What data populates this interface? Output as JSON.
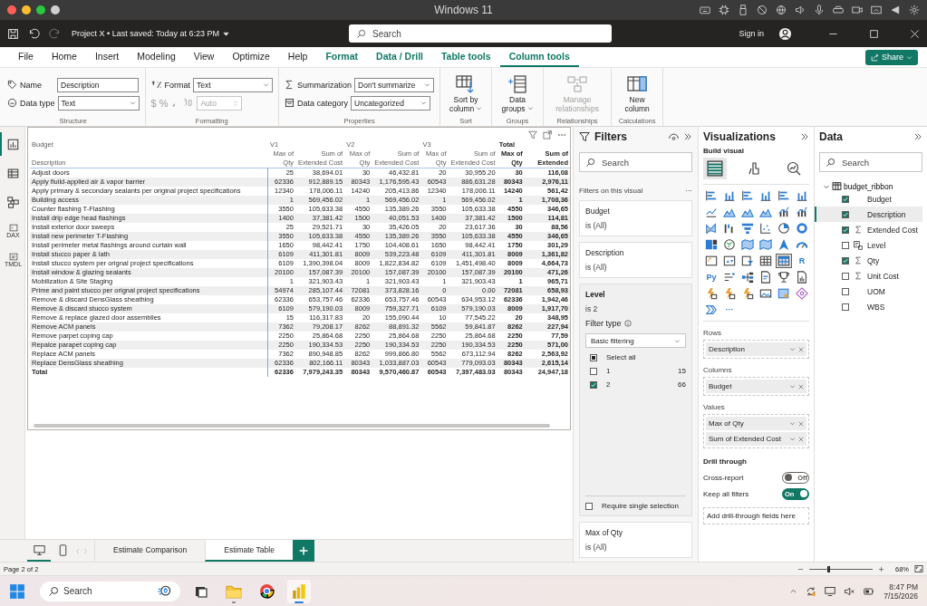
{
  "window": {
    "title": "Windows 11"
  },
  "app_bar": {
    "document": "Project X • Last saved: Today at 6:23 PM",
    "search_placeholder": "Search",
    "sign_in": "Sign in"
  },
  "ribbon_tabs": [
    {
      "label": "File",
      "kind": "main",
      "selected": false
    },
    {
      "label": "Home",
      "kind": "main",
      "selected": false
    },
    {
      "label": "Insert",
      "kind": "main",
      "selected": false
    },
    {
      "label": "Modeling",
      "kind": "main",
      "selected": false
    },
    {
      "label": "View",
      "kind": "main",
      "selected": false
    },
    {
      "label": "Optimize",
      "kind": "main",
      "selected": false
    },
    {
      "label": "Help",
      "kind": "main",
      "selected": false
    },
    {
      "label": "Format",
      "kind": "contextual",
      "selected": false
    },
    {
      "label": "Data / Drill",
      "kind": "contextual",
      "selected": false
    },
    {
      "label": "Table tools",
      "kind": "contextual",
      "selected": false
    },
    {
      "label": "Column tools",
      "kind": "contextual",
      "selected": true
    }
  ],
  "share": "Share",
  "ribbon_groups": [
    {
      "name": "Structure",
      "kind": "fields",
      "fields": [
        {
          "label": "Name",
          "value": "Description",
          "kind": "input"
        },
        {
          "label": "Data type",
          "value": "Text",
          "kind": "select"
        }
      ]
    },
    {
      "name": "Formatting",
      "kind": "format",
      "fields": [
        {
          "label": "Format",
          "value": "Text",
          "kind": "select"
        }
      ],
      "number_buttons": [
        "$",
        "%"
      ],
      "decimal_field": {
        "placeholder": "Auto",
        "disabled": true
      }
    },
    {
      "name": "Properties",
      "kind": "fields",
      "fields": [
        {
          "label": "Summarization",
          "value": "Don't summarize",
          "kind": "select"
        },
        {
          "label": "Data category",
          "value": "Uncategorized",
          "kind": "select"
        }
      ]
    },
    {
      "name": "Sort",
      "kind": "button",
      "label": "Sort by column",
      "dropdown": true,
      "disabled": false
    },
    {
      "name": "Groups",
      "kind": "button",
      "label": "Data groups",
      "dropdown": true,
      "disabled": false
    },
    {
      "name": "Relationships",
      "kind": "button",
      "label": "Manage relationships",
      "dropdown": false,
      "disabled": true
    },
    {
      "name": "Calculations",
      "kind": "button",
      "label": "New column",
      "dropdown": false,
      "disabled": false
    }
  ],
  "rail": [
    {
      "kind": "report",
      "selected": true
    },
    {
      "kind": "table",
      "selected": false
    },
    {
      "kind": "model",
      "selected": false
    },
    {
      "kind": "dax",
      "label": "DAX",
      "selected": false
    },
    {
      "kind": "tmdl",
      "label": "TMDL",
      "selected": false
    }
  ],
  "matrix": {
    "column_groups": [
      "Budget",
      "V1",
      "V2",
      "V3",
      "Total"
    ],
    "columns": [
      "Description",
      "Max of Qty",
      "Sum of Extended Cost",
      "Max of Qty",
      "Sum of Extended Cost",
      "Max of Qty",
      "Sum of Extended Cost",
      "Max of Qty",
      "Sum of Extended"
    ],
    "rows": [
      [
        "Adjust doors",
        "25",
        "38,694.01",
        "30",
        "46,432.81",
        "20",
        "30,955.20",
        "30",
        "116,08"
      ],
      [
        "Apply fluild-applied air & vapor barrier",
        "62336",
        "912,889.15",
        "80343",
        "1,176,595.43",
        "60543",
        "886,631.28",
        "80343",
        "2,976,11"
      ],
      [
        "Apply primary & secondary sealants per original project specifications",
        "12340",
        "178,006.11",
        "14240",
        "205,413.86",
        "12340",
        "178,006.11",
        "14240",
        "561,42"
      ],
      [
        "Building access",
        "1",
        "569,456.02",
        "1",
        "569,456.02",
        "1",
        "569,456.02",
        "1",
        "1,708,36"
      ],
      [
        "Counter flashing T-Flashing",
        "3550",
        "105,633.38",
        "4550",
        "135,389.26",
        "3550",
        "105,633.38",
        "4550",
        "346,65"
      ],
      [
        "Install drip edge head flashings",
        "1400",
        "37,381.42",
        "1500",
        "40,051.53",
        "1400",
        "37,381.42",
        "1500",
        "114,81"
      ],
      [
        "Install exterior door sweeps",
        "25",
        "29,521.71",
        "30",
        "35,426.05",
        "20",
        "23,617.36",
        "30",
        "88,56"
      ],
      [
        "Install new perimeter T-Flashing",
        "3550",
        "105,633.38",
        "4550",
        "135,389.26",
        "3550",
        "105,633.38",
        "4550",
        "346,65"
      ],
      [
        "Install perimeter metal flashings around curtain wall",
        "1650",
        "98,442.41",
        "1750",
        "104,408.61",
        "1650",
        "98,442.41",
        "1750",
        "301,29"
      ],
      [
        "Install stucco paper & lath",
        "6109",
        "411,301.81",
        "8009",
        "539,223.48",
        "6109",
        "411,301.81",
        "8009",
        "1,361,82"
      ],
      [
        "Install stucco system per orignal project specifications",
        "6109",
        "1,390,398.04",
        "8009",
        "1,822,834.82",
        "6109",
        "1,451,498.40",
        "8009",
        "4,664,73"
      ],
      [
        "Install window & glazing sealants",
        "20100",
        "157,087.39",
        "20100",
        "157,087.39",
        "20100",
        "157,087.39",
        "20100",
        "471,26"
      ],
      [
        "Mobilization & Site Staging",
        "1",
        "321,903.43",
        "1",
        "321,903.43",
        "1",
        "321,903.43",
        "1",
        "965,71"
      ],
      [
        "Prime and paint stucco per orignal project specifications",
        "54974",
        "285,107.44",
        "72081",
        "373,828.16",
        "0",
        "0.00",
        "72081",
        "658,93"
      ],
      [
        "Remove & discard DensGlass sheathing",
        "62336",
        "653,757.46",
        "62336",
        "653,757.46",
        "60543",
        "634,953.12",
        "62336",
        "1,942,46"
      ],
      [
        "Remove & discard stucco system",
        "6109",
        "579,190.03",
        "8009",
        "759,327.71",
        "6109",
        "579,190.03",
        "8009",
        "1,917,70"
      ],
      [
        "Remove & replace glazed door assemblies",
        "15",
        "116,317.83",
        "20",
        "155,090.44",
        "10",
        "77,545.22",
        "20",
        "348,95"
      ],
      [
        "Remove ACM panels",
        "7362",
        "79,208.17",
        "8262",
        "88,891.32",
        "5562",
        "59,841.87",
        "8262",
        "227,94"
      ],
      [
        "Remove parpet coping cap",
        "2250",
        "25,864.68",
        "2250",
        "25,864.68",
        "2250",
        "25,864.68",
        "2250",
        "77,59"
      ],
      [
        "Repalce parapet coping cap",
        "2250",
        "190,334.53",
        "2250",
        "190,334.53",
        "2250",
        "190,334.53",
        "2250",
        "571,00"
      ],
      [
        "Replace ACM panels",
        "7362",
        "890,948.85",
        "8262",
        "999,866.80",
        "5562",
        "673,112.94",
        "8262",
        "2,563,92"
      ],
      [
        "Replace DensGlass sheathing",
        "62336",
        "802,166.11",
        "80343",
        "1,033,887.03",
        "60543",
        "779,093.03",
        "80343",
        "2,615,14"
      ]
    ],
    "total": [
      "Total",
      "62336",
      "7,979,243.35",
      "80343",
      "9,570,460.87",
      "60543",
      "7,397,483.03",
      "80343",
      "24,947,18"
    ]
  },
  "filters": {
    "title": "Filters",
    "search_placeholder": "Search",
    "section": "Filters on this visual",
    "more": "···",
    "cards": [
      {
        "field": "Budget",
        "summary": "is (All)",
        "expanded": false
      },
      {
        "field": "Description",
        "summary": "is (All)",
        "expanded": false
      },
      {
        "field": "Level",
        "summary": "is 2",
        "expanded": true,
        "filter_type_label": "Filter type",
        "filter_type": "Basic filtering",
        "options": [
          {
            "label": "Select all",
            "kind": "select-all",
            "partial": true
          },
          {
            "label": "1",
            "count": "15",
            "kind": "value",
            "checked": false
          },
          {
            "label": "2",
            "count": "66",
            "kind": "value",
            "checked": true
          }
        ],
        "require_single": {
          "label": "Require single selection",
          "checked": false
        }
      },
      {
        "field": "Max of Qty",
        "summary": "is (All)",
        "expanded": false
      }
    ]
  },
  "visualizations": {
    "title": "Visualizations",
    "subtitle": "Build visual",
    "build_tabs": [
      {
        "kind": "build",
        "selected": true
      },
      {
        "kind": "format",
        "selected": false
      },
      {
        "kind": "analytics",
        "selected": false
      }
    ],
    "types": [
      {
        "kind": "bar",
        "selected": false
      },
      {
        "kind": "column",
        "selected": false
      },
      {
        "kind": "bar",
        "selected": false
      },
      {
        "kind": "column",
        "selected": false
      },
      {
        "kind": "bar",
        "selected": false
      },
      {
        "kind": "column",
        "selected": false
      },
      {
        "kind": "line",
        "selected": false
      },
      {
        "kind": "area",
        "selected": false
      },
      {
        "kind": "area",
        "selected": false
      },
      {
        "kind": "area",
        "selected": false
      },
      {
        "kind": "combo",
        "selected": false
      },
      {
        "kind": "combo",
        "selected": false
      },
      {
        "kind": "ribbon",
        "selected": false
      },
      {
        "kind": "waterfall",
        "selected": false
      },
      {
        "kind": "funnel",
        "selected": false
      },
      {
        "kind": "scatter",
        "selected": false
      },
      {
        "kind": "pie",
        "selected": false
      },
      {
        "kind": "donut",
        "selected": false
      },
      {
        "kind": "treemap",
        "selected": false
      },
      {
        "kind": "globe",
        "selected": false
      },
      {
        "kind": "map",
        "selected": false
      },
      {
        "kind": "map",
        "selected": false
      },
      {
        "kind": "arrow",
        "selected": false
      },
      {
        "kind": "gauge",
        "selected": false
      },
      {
        "kind": "card",
        "selected": false
      },
      {
        "kind": "kpi",
        "selected": false
      },
      {
        "kind": "slicer",
        "selected": false
      },
      {
        "kind": "table",
        "selected": false
      },
      {
        "kind": "matrix",
        "selected": true
      },
      {
        "kind": "script",
        "label": "R",
        "selected": false
      },
      {
        "kind": "script",
        "label": "Py",
        "selected": false
      },
      {
        "kind": "list",
        "selected": false
      },
      {
        "kind": "tree",
        "selected": false
      },
      {
        "kind": "document",
        "selected": false
      },
      {
        "kind": "trophy",
        "selected": false
      },
      {
        "kind": "report",
        "selected": false
      },
      {
        "kind": "bolt",
        "selected": false
      },
      {
        "kind": "bolt",
        "selected": false
      },
      {
        "kind": "bolt",
        "selected": false
      },
      {
        "kind": "image",
        "selected": false
      },
      {
        "kind": "pin",
        "selected": false
      },
      {
        "kind": "diamond",
        "selected": false
      },
      {
        "kind": "chevrons",
        "selected": false
      },
      {
        "kind": "more",
        "label": "···",
        "selected": false
      }
    ],
    "wells": [
      {
        "title": "Rows",
        "fields": [
          "Description"
        ]
      },
      {
        "title": "Columns",
        "fields": [
          "Budget"
        ]
      },
      {
        "title": "Values",
        "fields": [
          "Max of Qty",
          "Sum of Extended Cost"
        ]
      }
    ],
    "drill_through": {
      "title": "Drill through",
      "toggles": [
        {
          "label": "Cross-report",
          "on": false,
          "state_text": "Off"
        },
        {
          "label": "Keep all filters",
          "on": true,
          "state_text": "On"
        }
      ],
      "drop_placeholder": "Add drill-through fields here"
    }
  },
  "data": {
    "title": "Data",
    "search_placeholder": "Search",
    "tables": [
      {
        "name": "budget_ribbon",
        "expanded": true,
        "children": [
          {
            "name": "Budget",
            "kind": "text",
            "checked": true,
            "selected": false
          },
          {
            "name": "Description",
            "kind": "text",
            "checked": true,
            "selected": true
          },
          {
            "name": "Extended Cost",
            "kind": "sum",
            "checked": true,
            "selected": false
          },
          {
            "name": "Level",
            "kind": "hierarchy",
            "checked": false,
            "selected": false
          },
          {
            "name": "Qty",
            "kind": "sum",
            "checked": true,
            "selected": false
          },
          {
            "name": "Unit Cost",
            "kind": "sum",
            "checked": false,
            "selected": false
          },
          {
            "name": "UOM",
            "kind": "text",
            "checked": false,
            "selected": false
          },
          {
            "name": "WBS",
            "kind": "text",
            "checked": false,
            "selected": false
          }
        ]
      }
    ]
  },
  "pages": {
    "devices": [
      {
        "kind": "desktop",
        "selected": true
      },
      {
        "kind": "phone",
        "selected": false
      }
    ],
    "tabs": [
      {
        "label": "Estimate Comparison",
        "selected": false
      },
      {
        "label": "Estimate Table",
        "selected": true
      }
    ]
  },
  "status": {
    "page": "Page 2 of 2",
    "zoom_slider": {
      "level": 0.3
    },
    "zoom": "68%"
  },
  "taskbar": {
    "search_placeholder": "Search",
    "apps": [
      {
        "kind": "task-view",
        "running": false,
        "selected": false
      },
      {
        "kind": "folder",
        "running": true,
        "selected": false
      },
      {
        "kind": "browser",
        "running": false,
        "selected": false
      },
      {
        "kind": "bar-chart",
        "running": true,
        "selected": true
      }
    ],
    "time": "8:47 PM",
    "date": "7/15/2026"
  }
}
